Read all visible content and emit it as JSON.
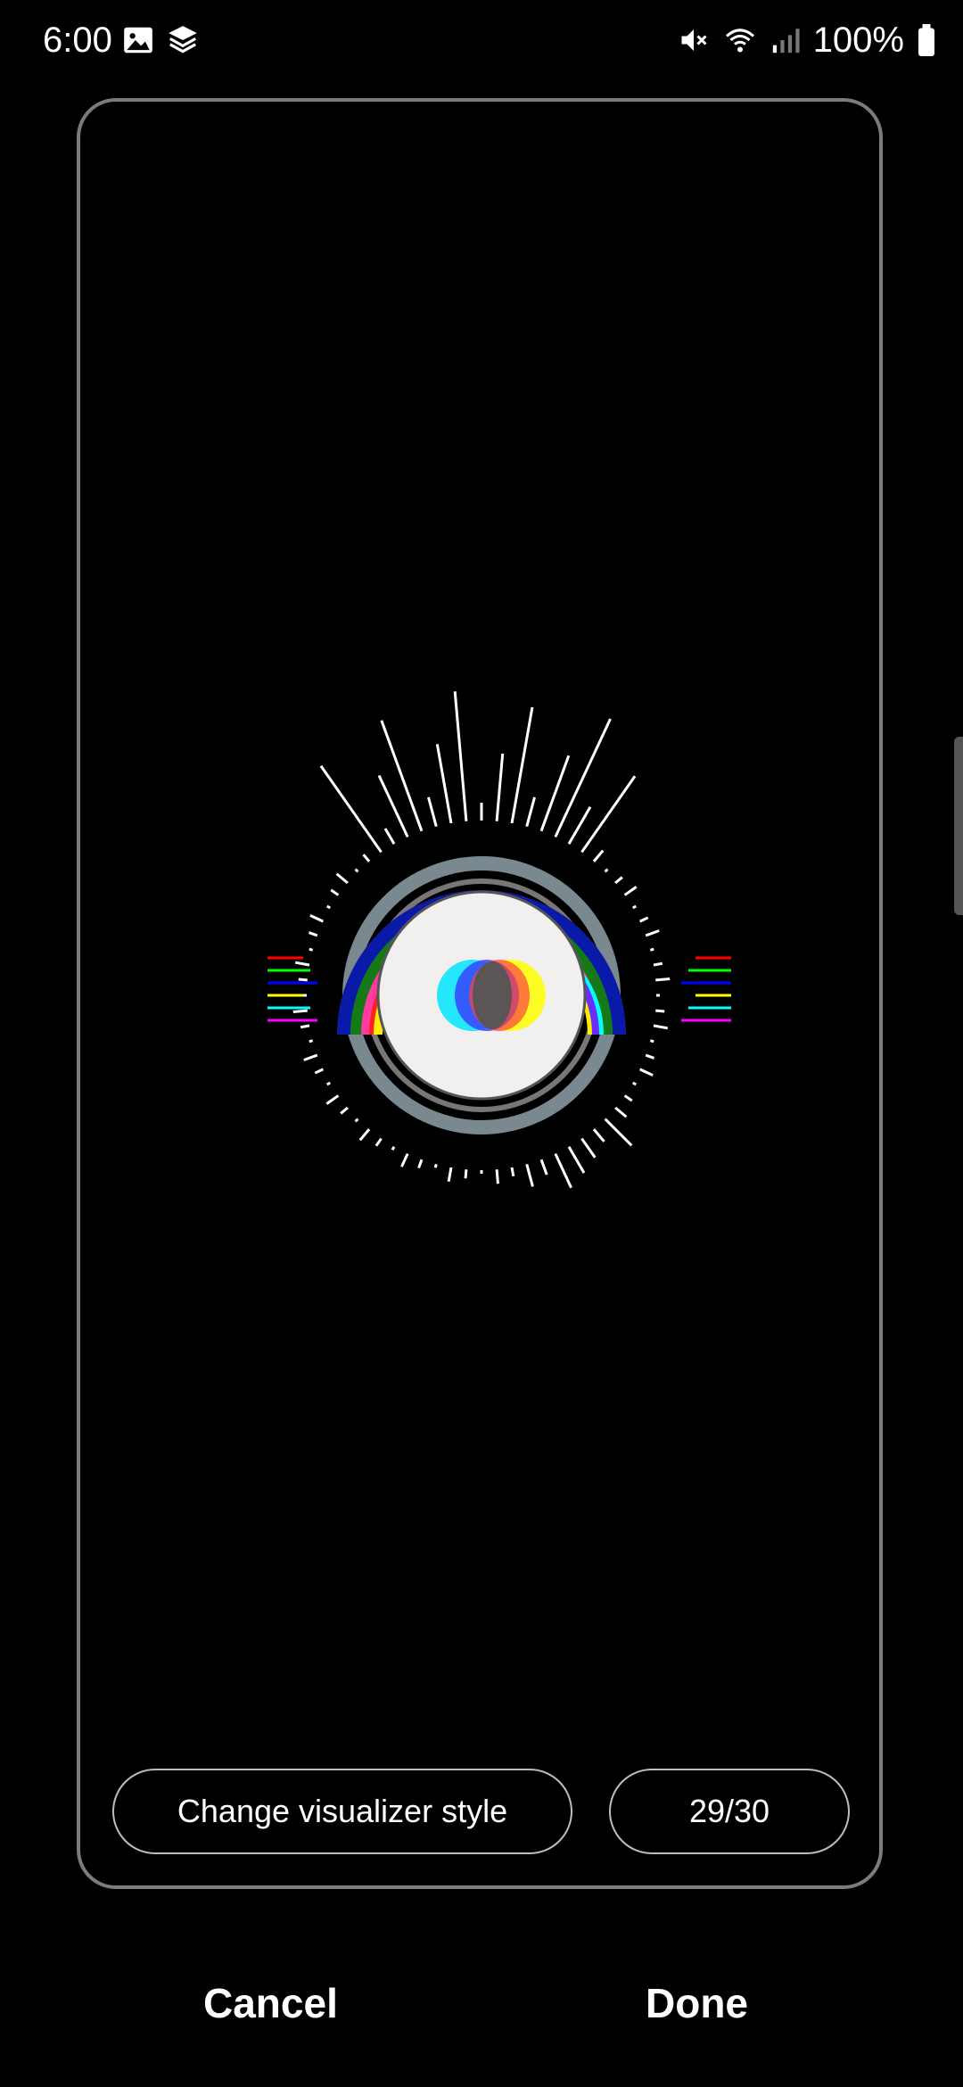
{
  "status_bar": {
    "time": "6:00",
    "left_icons": [
      "gallery-icon",
      "layers-icon"
    ],
    "right_icons": [
      "mute-icon",
      "wifi-icon",
      "signal-icon",
      "battery-icon"
    ],
    "battery": "100%"
  },
  "visualizer": {
    "style_button_label": "Change visualizer style",
    "style_counter": "29/30",
    "colors": [
      "#ff0000",
      "#00ff00",
      "#0000ff",
      "#ffff00",
      "#00ffff",
      "#ff00ff",
      "#f2f0ef",
      "#7a8890"
    ]
  },
  "actions": {
    "cancel_label": "Cancel",
    "done_label": "Done"
  }
}
